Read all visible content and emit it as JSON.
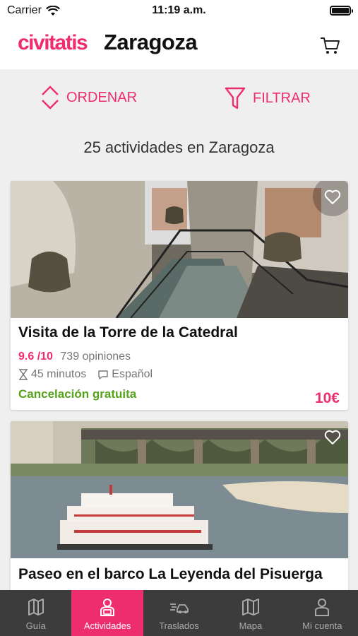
{
  "status": {
    "carrier": "Carrier",
    "time": "11:19 a.m."
  },
  "header": {
    "brand": "civitatis",
    "city": "Zaragoza"
  },
  "toolbar": {
    "sort_label": "ORDENAR",
    "filter_label": "FILTRAR"
  },
  "results": {
    "count_text": "25 actividades en Zaragoza"
  },
  "activities": [
    {
      "title": "Visita de la Torre de la Catedral",
      "score": "9.6 /10",
      "opinions": "739 opiniones",
      "duration": "45 minutos",
      "language": "Español",
      "cancellation": "Cancelación gratuita",
      "price": "10€"
    },
    {
      "title": "Paseo en el barco La Leyenda del Pisuerga"
    }
  ],
  "tabs": [
    {
      "label": "Guía",
      "icon": "map-guide-icon"
    },
    {
      "label": "Actividades",
      "icon": "person-badge-icon"
    },
    {
      "label": "Traslados",
      "icon": "car-transfer-icon"
    },
    {
      "label": "Mapa",
      "icon": "map-icon"
    },
    {
      "label": "Mi cuenta",
      "icon": "user-icon"
    }
  ],
  "colors": {
    "brand": "#ee2d6e",
    "green": "#54a31b",
    "tabbar": "#3c3c3c"
  }
}
